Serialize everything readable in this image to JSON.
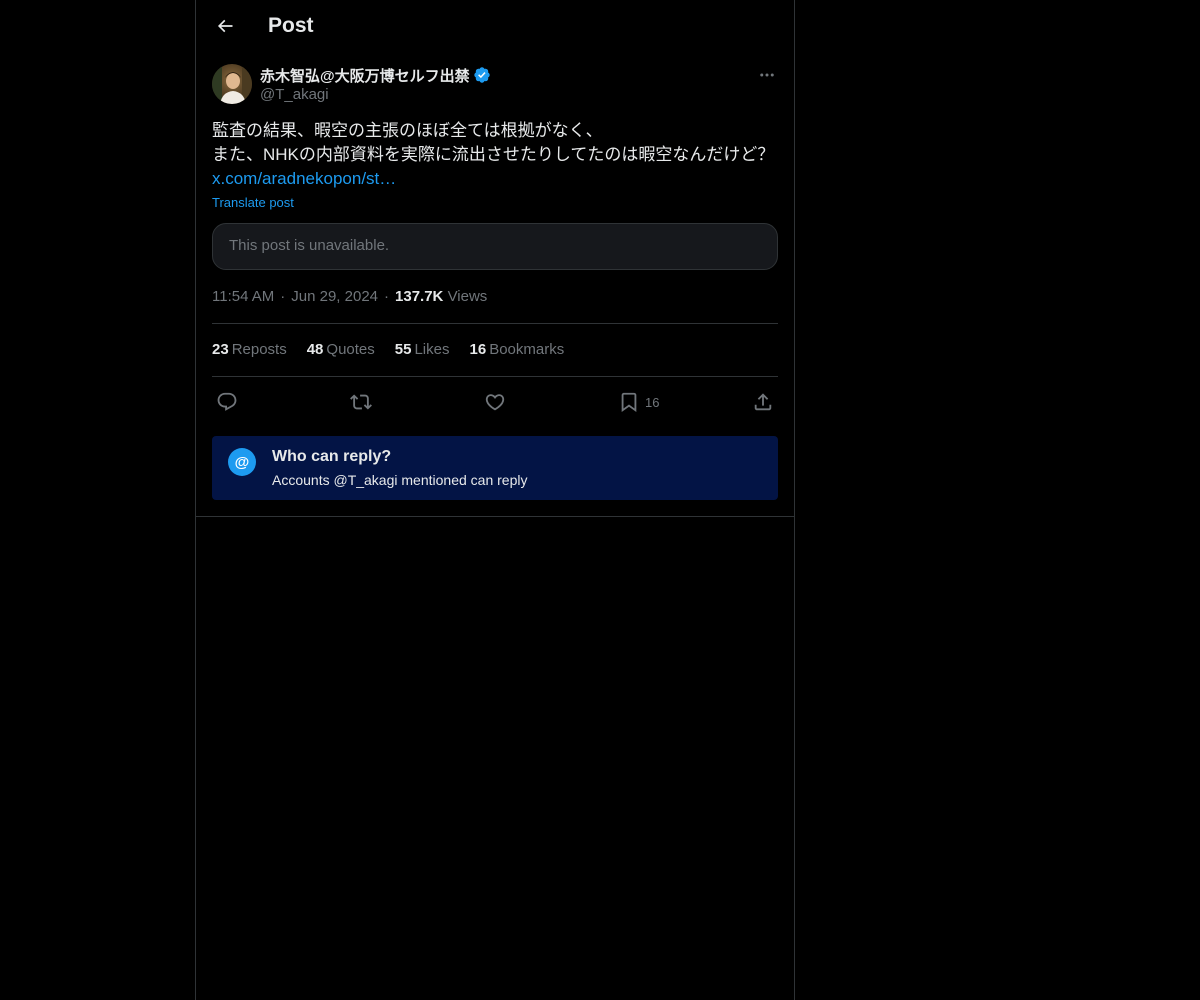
{
  "header": {
    "title": "Post",
    "back_icon": "arrow-left-icon"
  },
  "post": {
    "author": {
      "display_name": "赤木智弘@大阪万博セルフ出禁",
      "handle": "@T_akagi",
      "verified": true,
      "verified_color": "#1d9bf0"
    },
    "text_line1": "監査の結果、暇空の主張のほぼ全ては根拠がなく、",
    "text_line2": "また、NHKの内部資料を実際に流出させたりしてたのは暇空なんだけど？",
    "link": "x.com/aradnekopon/st…",
    "translate_label": "Translate post",
    "quoted_unavailable": "This post is unavailable.",
    "time": "11:54 AM",
    "date": "Jun 29, 2024",
    "views_count": "137.7K",
    "views_label": "Views",
    "separator": "·"
  },
  "stats": {
    "reposts_count": "23",
    "reposts_label": "Reposts",
    "quotes_count": "48",
    "quotes_label": "Quotes",
    "likes_count": "55",
    "likes_label": "Likes",
    "bookmarks_count": "16",
    "bookmarks_label": "Bookmarks"
  },
  "actions": {
    "reply_icon": "reply-icon",
    "repost_icon": "repost-icon",
    "like_icon": "heart-icon",
    "bookmark_icon": "bookmark-icon",
    "bookmark_count": "16",
    "share_icon": "share-icon"
  },
  "reply_restriction": {
    "icon_glyph": "@",
    "title": "Who can reply?",
    "subtitle": "Accounts @T_akagi mentioned can reply",
    "background": "#031445"
  },
  "colors": {
    "accent": "#1d9bf0",
    "text": "#e7e9ea",
    "muted": "#71767b",
    "border": "#2f3336"
  }
}
